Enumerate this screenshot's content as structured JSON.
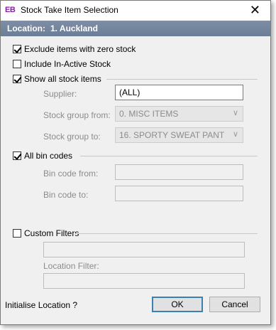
{
  "window": {
    "icon_text": "EB",
    "title": "Stock Take Item Selection",
    "close_glyph": "✕"
  },
  "location": {
    "label": "Location:",
    "value": "1. Auckland"
  },
  "options": {
    "exclude_zero": {
      "label": "Exclude items with zero stock",
      "checked": true
    },
    "include_inactive": {
      "label": "Include In-Active Stock",
      "checked": false
    },
    "show_all_stock": {
      "label": "Show all stock items",
      "checked": true
    },
    "all_bin_codes": {
      "label": "All bin codes",
      "checked": true
    },
    "custom_filters": {
      "label": "Custom Filters",
      "checked": false
    }
  },
  "stock": {
    "supplier_label": "Supplier:",
    "supplier_value": "(ALL)",
    "group_from_label": "Stock group from:",
    "group_from_value": "0. MISC ITEMS",
    "group_to_label": "Stock group to:",
    "group_to_value": "16. SPORTY SWEAT PANT"
  },
  "bins": {
    "from_label": "Bin code from:",
    "from_value": "",
    "to_label": "Bin code to:",
    "to_value": ""
  },
  "custom": {
    "filter_value": "",
    "location_filter_label": "Location Filter:",
    "location_filter_value": ""
  },
  "footer": {
    "initialise_text": "Initialise Location ?",
    "ok_label": "OK",
    "cancel_label": "Cancel"
  },
  "icons": {
    "dropdown": "chevron-down-icon",
    "close": "close-icon"
  }
}
